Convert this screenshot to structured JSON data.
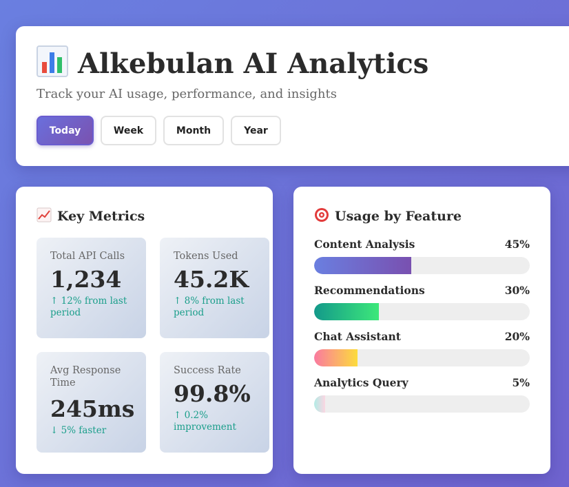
{
  "header": {
    "icon": "bar-chart-icon",
    "title": "Alkebulan AI Analytics",
    "subtitle": "Track your AI usage, performance, and insights",
    "tabs": [
      {
        "label": "Today",
        "active": true
      },
      {
        "label": "Week",
        "active": false
      },
      {
        "label": "Month",
        "active": false
      },
      {
        "label": "Year",
        "active": false
      }
    ]
  },
  "metrics": {
    "icon": "trending-up-icon",
    "title": "Key Metrics",
    "items": [
      {
        "label": "Total API Calls",
        "value": "1,234",
        "change": "↑ 12% from last period"
      },
      {
        "label": "Tokens Used",
        "value": "45.2K",
        "change": "↑ 8% from last period"
      },
      {
        "label": "Avg Response Time",
        "value": "245ms",
        "change": "↓ 5% faster"
      },
      {
        "label": "Success Rate",
        "value": "99.8%",
        "change": "↑ 0.2% improvement"
      }
    ]
  },
  "usage": {
    "icon": "target-icon",
    "title": "Usage by Feature",
    "features": [
      {
        "name": "Content Analysis",
        "percent_label": "45%",
        "percent": 45
      },
      {
        "name": "Recommendations",
        "percent_label": "30%",
        "percent": 30
      },
      {
        "name": "Chat Assistant",
        "percent_label": "20%",
        "percent": 20
      },
      {
        "name": "Analytics Query",
        "percent_label": "5%",
        "percent": 5
      }
    ]
  },
  "colors": {
    "accent": "#6a6fdc",
    "positive_change": "#1a9e8a"
  }
}
